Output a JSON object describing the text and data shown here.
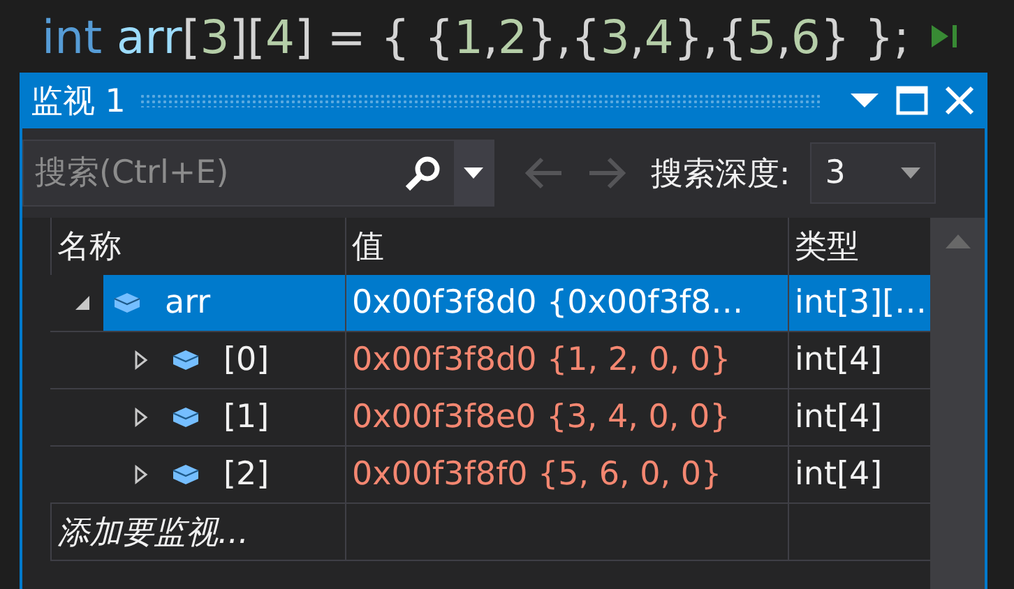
{
  "code_line": {
    "tokens": [
      {
        "text": "int",
        "kind": "keyword"
      },
      {
        "text": " arr",
        "kind": "variable"
      },
      {
        "text": "[",
        "kind": "punct"
      },
      {
        "text": "3",
        "kind": "number"
      },
      {
        "text": "][",
        "kind": "punct"
      },
      {
        "text": "4",
        "kind": "number"
      },
      {
        "text": "] = { {",
        "kind": "punct"
      },
      {
        "text": "1",
        "kind": "number"
      },
      {
        "text": ",",
        "kind": "punct"
      },
      {
        "text": "2",
        "kind": "number"
      },
      {
        "text": "},{",
        "kind": "punct"
      },
      {
        "text": "3",
        "kind": "number"
      },
      {
        "text": ",",
        "kind": "punct"
      },
      {
        "text": "4",
        "kind": "number"
      },
      {
        "text": "},{",
        "kind": "punct"
      },
      {
        "text": "5",
        "kind": "number"
      },
      {
        "text": ",",
        "kind": "punct"
      },
      {
        "text": "6",
        "kind": "number"
      },
      {
        "text": "} };",
        "kind": "punct"
      }
    ]
  },
  "watch_window": {
    "title": "监视 1",
    "toolbar": {
      "search": {
        "placeholder": "搜索(Ctrl+E)"
      },
      "nav_buttons": [
        {
          "kind": "back",
          "disabled": true
        },
        {
          "kind": "forward",
          "disabled": true
        }
      ],
      "depth_label": "搜索深度:",
      "depth_value": "3"
    },
    "table": {
      "columns": [
        "名称",
        "值",
        "类型"
      ],
      "rows": [
        {
          "name": "arr",
          "value": "0x00f3f8d0 {0x00f3f8…",
          "type": "int[3][…",
          "selected": true,
          "expanded": true,
          "changed": false,
          "children": [
            {
              "name": "[0]",
              "value": "0x00f3f8d0 {1, 2, 0, 0}",
              "type": "int[4]",
              "selected": false,
              "expanded": false,
              "changed": true
            },
            {
              "name": "[1]",
              "value": "0x00f3f8e0 {3, 4, 0, 0}",
              "type": "int[4]",
              "selected": false,
              "expanded": false,
              "changed": true
            },
            {
              "name": "[2]",
              "value": "0x00f3f8f0 {5, 6, 0, 0}",
              "type": "int[4]",
              "selected": false,
              "expanded": false,
              "changed": true
            }
          ]
        }
      ],
      "add_row": {
        "placeholder": "添加要监视..."
      }
    }
  }
}
